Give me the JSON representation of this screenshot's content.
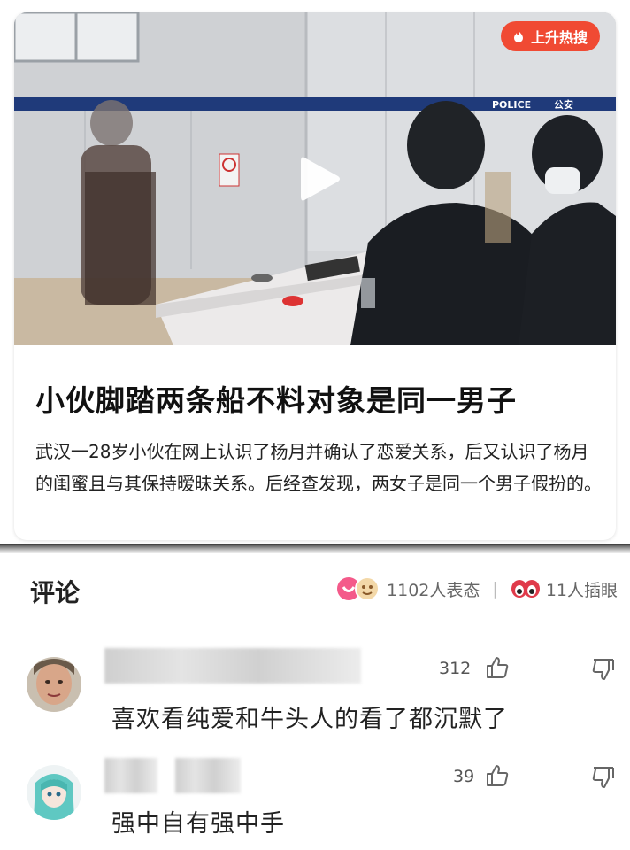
{
  "article": {
    "badge": "上升热搜",
    "headline": "小伙脚踏两条船不料对象是同一男子",
    "summary": "武汉一28岁小伙在网上认识了杨月并确认了恋爱关系，后又认识了杨月的闺蜜且与其保持暧昧关系。后经查发现，两女子是同一个男子假扮的。",
    "video_text": {
      "police_tape": "POLICE",
      "police_tape_cn": "公安"
    }
  },
  "comments_section": {
    "title": "评论",
    "reactions_count": "1102人表态",
    "separator": "|",
    "eyes_count": "11人插眼"
  },
  "comments": [
    {
      "likes": "312",
      "text": "喜欢看纯爱和牛头人的看了都沉默了"
    },
    {
      "likes": "39",
      "text": "强中自有强中手"
    }
  ],
  "colors": {
    "badge": "#f04a33",
    "police_blue": "#1f3a7a",
    "text": "#222222"
  }
}
